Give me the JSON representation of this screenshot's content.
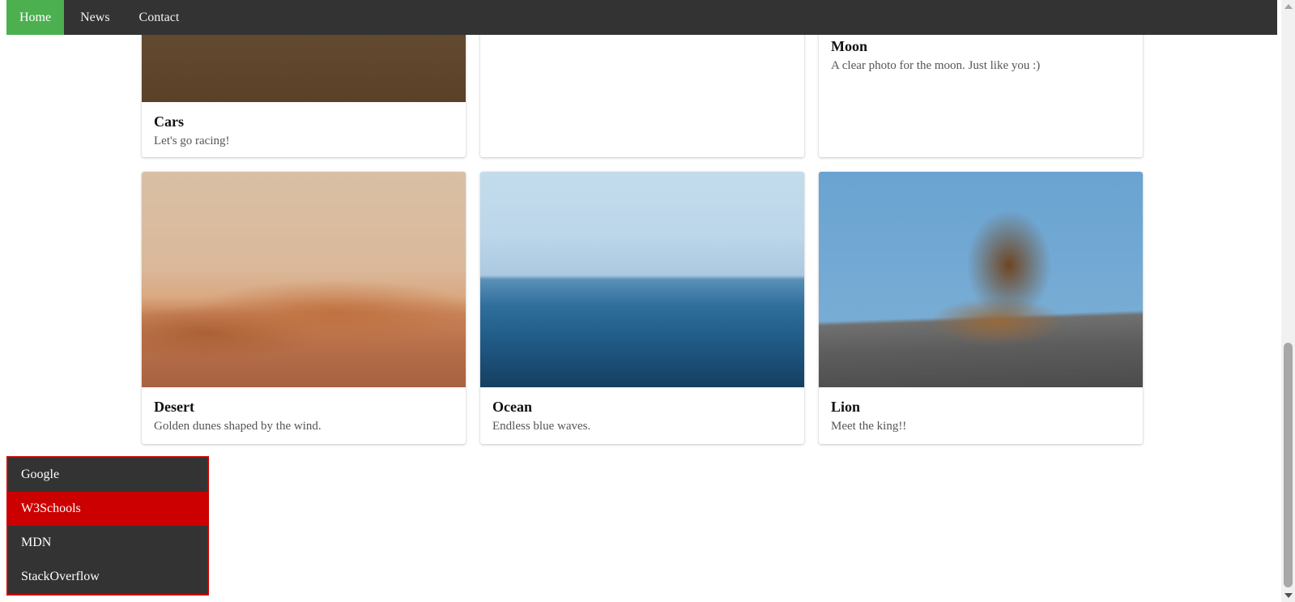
{
  "nav": {
    "items": [
      {
        "label": "Home",
        "active": true
      },
      {
        "label": "News",
        "active": false
      },
      {
        "label": "Contact",
        "active": false
      }
    ],
    "active_color": "#4CAF50",
    "background": "#333333"
  },
  "cards": {
    "row1": [
      {
        "title": "Cars",
        "desc": "Let's go racing!",
        "image": "car-photo"
      },
      {
        "title": "",
        "desc": "",
        "image": "blank"
      },
      {
        "title": "Moon",
        "desc": "A clear photo for the moon. Just like you :)",
        "image": "moon-photo"
      }
    ],
    "row2": [
      {
        "title": "Desert",
        "desc": "Golden dunes shaped by the wind.",
        "image": "desert-photo"
      },
      {
        "title": "Ocean",
        "desc": "Endless blue waves.",
        "image": "ocean-photo"
      },
      {
        "title": "Lion",
        "desc": "Meet the king!!",
        "image": "lion-photo"
      }
    ]
  },
  "menu": {
    "items": [
      {
        "label": "Google",
        "highlighted": false
      },
      {
        "label": "W3Schools",
        "highlighted": true
      },
      {
        "label": "MDN",
        "highlighted": false
      },
      {
        "label": "StackOverflow",
        "highlighted": false
      }
    ],
    "border_color": "#cc0000",
    "highlight_color": "#cc0000"
  }
}
